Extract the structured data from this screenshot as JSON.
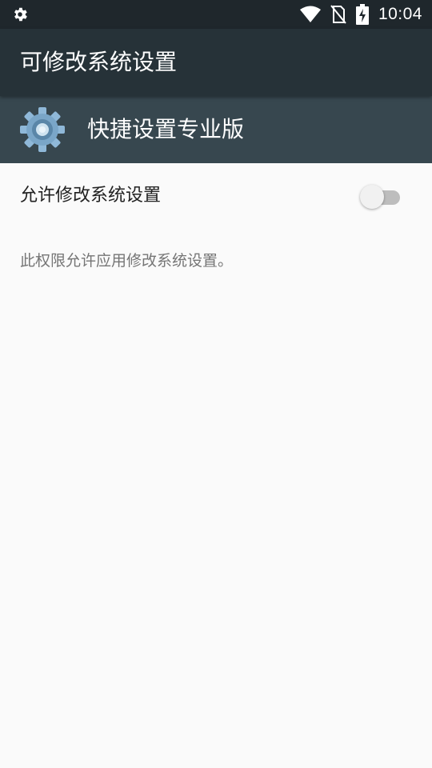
{
  "status_bar": {
    "time": "10:04",
    "icons": [
      "settings-notification-icon",
      "wifi-icon",
      "no-sim-icon",
      "battery-charging-icon"
    ]
  },
  "toolbar": {
    "title": "可修改系统设置"
  },
  "app_header": {
    "app_name": "快捷设置专业版",
    "icon": "app-gear-icon"
  },
  "setting": {
    "label": "允许修改系统设置",
    "enabled": false
  },
  "description": "此权限允许应用修改系统设置。",
  "colors": {
    "status_bar": "#1f272c",
    "toolbar": "#263238",
    "app_header": "#37474f",
    "background": "#fafafa",
    "switch_track_off": "#bdbdbd",
    "switch_thumb_off": "#f1f1f1"
  }
}
